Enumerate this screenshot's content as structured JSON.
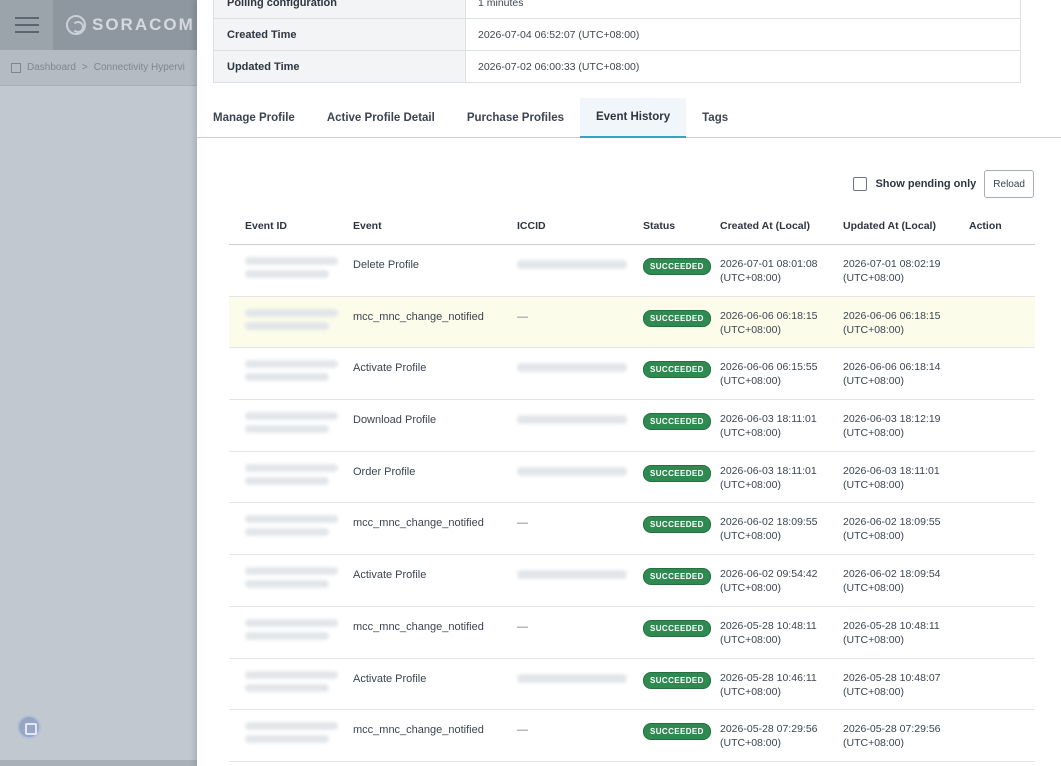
{
  "background": {
    "logo_text": "SORACOM",
    "breadcrumb": [
      "Dashboard",
      ">",
      "Connectivity Hypervi"
    ]
  },
  "info": [
    {
      "key": "Polling configuration",
      "value": "1 minutes"
    },
    {
      "key": "Created Time",
      "value": "2026-07-04 06:52:07 (UTC+08:00)"
    },
    {
      "key": "Updated Time",
      "value": "2026-07-02 06:00:33 (UTC+08:00)"
    }
  ],
  "tabs": [
    {
      "label": "Manage Profile"
    },
    {
      "label": "Active Profile Detail"
    },
    {
      "label": "Purchase Profiles"
    },
    {
      "label": "Event History",
      "active": true
    },
    {
      "label": "Tags"
    }
  ],
  "toolbar": {
    "show_pending_label": "Show pending only",
    "show_pending_checked": false,
    "reload_label": "Reload"
  },
  "table": {
    "headers": {
      "event_id": "Event ID",
      "event": "Event",
      "iccid": "ICCID",
      "status": "Status",
      "created": "Created At (Local)",
      "updated": "Updated At (Local)",
      "action": "Action"
    },
    "rows": [
      {
        "event": "Delete Profile",
        "iccid": "",
        "status": "SUCCEEDED",
        "created_date": "2026-07-01 08:01:08",
        "created_tz": "(UTC+08:00)",
        "updated_date": "2026-07-01 08:02:19",
        "updated_tz": "(UTC+08:00)"
      },
      {
        "event": "mcc_mnc_change_notified",
        "iccid": "—",
        "status": "SUCCEEDED",
        "created_date": "2026-06-06 06:18:15",
        "created_tz": "(UTC+08:00)",
        "updated_date": "2026-06-06 06:18:15",
        "updated_tz": "(UTC+08:00)"
      },
      {
        "event": "Activate Profile",
        "iccid": "",
        "status": "SUCCEEDED",
        "created_date": "2026-06-06 06:15:55",
        "created_tz": "(UTC+08:00)",
        "updated_date": "2026-06-06 06:18:14",
        "updated_tz": "(UTC+08:00)"
      },
      {
        "event": "Download Profile",
        "iccid": "",
        "status": "SUCCEEDED",
        "created_date": "2026-06-03 18:11:01",
        "created_tz": "(UTC+08:00)",
        "updated_date": "2026-06-03 18:12:19",
        "updated_tz": "(UTC+08:00)"
      },
      {
        "event": "Order Profile",
        "iccid": "",
        "status": "SUCCEEDED",
        "created_date": "2026-06-03 18:11:01",
        "created_tz": "(UTC+08:00)",
        "updated_date": "2026-06-03 18:11:01",
        "updated_tz": "(UTC+08:00)"
      },
      {
        "event": "mcc_mnc_change_notified",
        "iccid": "—",
        "status": "SUCCEEDED",
        "created_date": "2026-06-02 18:09:55",
        "created_tz": "(UTC+08:00)",
        "updated_date": "2026-06-02 18:09:55",
        "updated_tz": "(UTC+08:00)"
      },
      {
        "event": "Activate Profile",
        "iccid": "",
        "status": "SUCCEEDED",
        "created_date": "2026-06-02 09:54:42",
        "created_tz": "(UTC+08:00)",
        "updated_date": "2026-06-02 18:09:54",
        "updated_tz": "(UTC+08:00)"
      },
      {
        "event": "mcc_mnc_change_notified",
        "iccid": "—",
        "status": "SUCCEEDED",
        "created_date": "2026-05-28 10:48:11",
        "created_tz": "(UTC+08:00)",
        "updated_date": "2026-05-28 10:48:11",
        "updated_tz": "(UTC+08:00)"
      },
      {
        "event": "Activate Profile",
        "iccid": "",
        "status": "SUCCEEDED",
        "created_date": "2026-05-28 10:46:11",
        "created_tz": "(UTC+08:00)",
        "updated_date": "2026-05-28 10:48:07",
        "updated_tz": "(UTC+08:00)"
      },
      {
        "event": "mcc_mnc_change_notified",
        "iccid": "—",
        "status": "SUCCEEDED",
        "created_date": "2026-05-28 07:29:56",
        "created_tz": "(UTC+08:00)",
        "updated_date": "2026-05-28 07:29:56",
        "updated_tz": "(UTC+08:00)"
      }
    ]
  },
  "colors": {
    "status_success": "#2f8a52",
    "tab_accent": "#33a5c9",
    "row_highlight": "#fcfcea"
  }
}
